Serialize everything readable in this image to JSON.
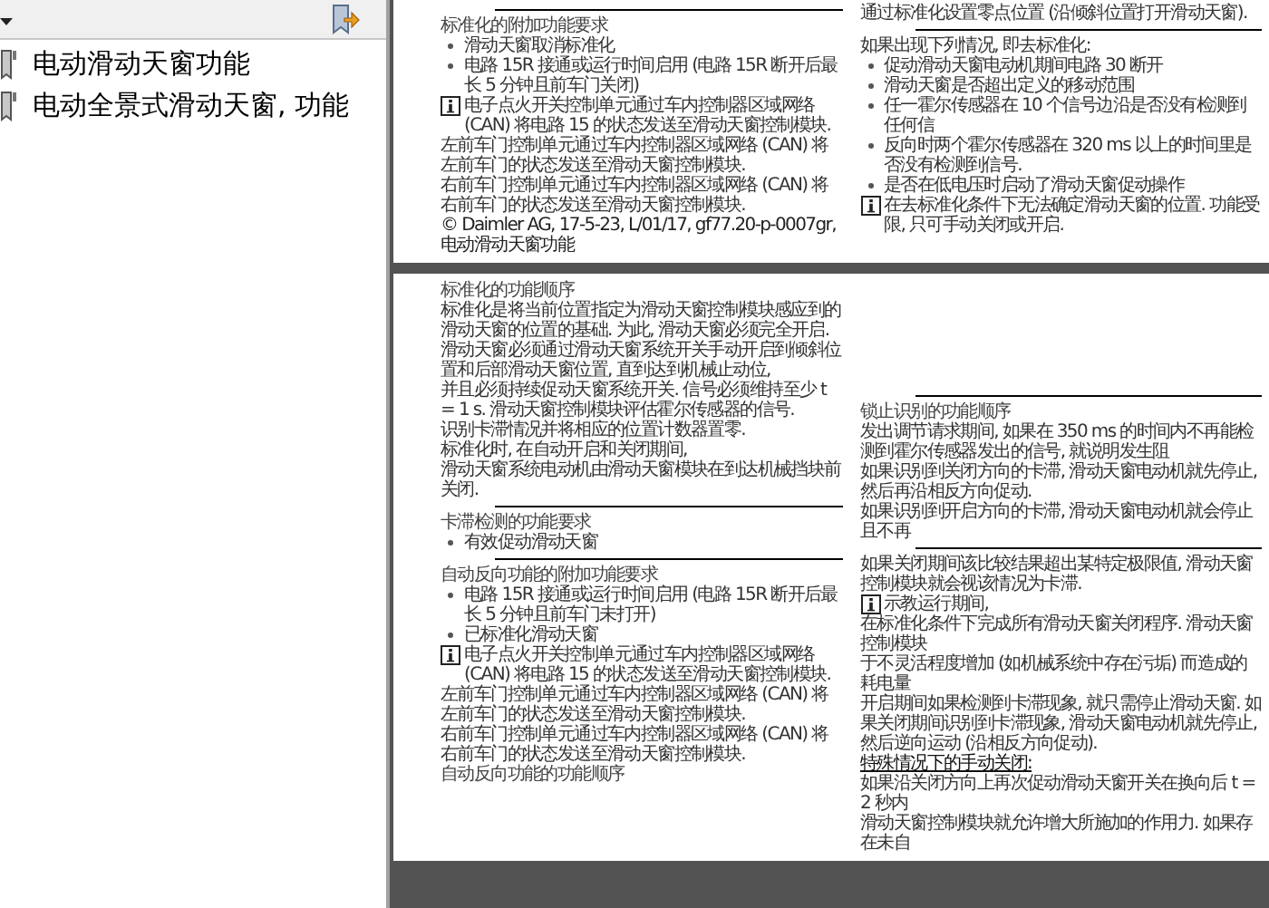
{
  "sidebar": {
    "items": [
      {
        "label": "电动滑动天窗功能"
      },
      {
        "label": "电动全景式滑动天窗, 功能"
      }
    ]
  },
  "pages": [
    {
      "columns": [
        [
          {
            "kind": "rule"
          },
          {
            "kind": "heading",
            "text": "标准化的附加功能要求"
          },
          {
            "kind": "bullet",
            "text": "滑动天窗取消标准化"
          },
          {
            "kind": "bullet",
            "text": "电路 15R 接通或运行时间启用 (电路 15R 断开后最长 5 分钟且前车门关闭)"
          },
          {
            "kind": "info",
            "text": "电子点火开关控制单元通过车内控制器区域网络 (CAN) 将电路 15 的状态发送至滑动天窗控制模块."
          },
          {
            "kind": "para",
            "text": "左前车门控制单元通过车内控制器区域网络 (CAN) 将左前车门的状态发送至滑动天窗控制模块."
          },
          {
            "kind": "para",
            "text": "右前车门控制单元通过车内控制器区域网络 (CAN) 将右前车门的状态发送至滑动天窗控制模块."
          },
          {
            "kind": "note",
            "text": "© Daimler AG, 17-5-23, L/01/17, gf77.20-p-0007gr, 电动滑动天窗功能"
          }
        ],
        [
          {
            "kind": "para",
            "text": "通过标准化设置零点位置 (沿倾斜位置打开滑动天窗)."
          },
          {
            "kind": "rule"
          },
          {
            "kind": "para",
            "text": "如果出现下列情况, 即去标准化:"
          },
          {
            "kind": "bullet",
            "text": "促动滑动天窗电动机期间电路 30 断开"
          },
          {
            "kind": "bullet",
            "text": "滑动天窗是否超出定义的移动范围"
          },
          {
            "kind": "bullet",
            "text": "任一霍尔传感器在 10 个信号边沿是否没有检测到任何信"
          },
          {
            "kind": "bullet",
            "text": "反向时两个霍尔传感器在 320 ms 以上的时间里是否没有检测到信号."
          },
          {
            "kind": "bullet",
            "text": "是否在低电压时启动了滑动天窗促动操作"
          },
          {
            "kind": "info",
            "text": "在去标准化条件下无法确定滑动天窗的位置. 功能受限, 只可手动关闭或开启."
          }
        ]
      ]
    },
    {
      "columns": [
        [
          {
            "kind": "heading",
            "text": "标准化的功能顺序"
          },
          {
            "kind": "para",
            "text": "标准化是将当前位置指定为滑动天窗控制模块感应到的滑动天窗的位置的基础. 为此, 滑动天窗必须完全开启."
          },
          {
            "kind": "para",
            "text": "滑动天窗必须通过滑动天窗系统开关手动开启到倾斜位置和后部滑动天窗位置, 直到达到机械止动位,"
          },
          {
            "kind": "para",
            "text": "并且必须持续促动天窗系统开关. 信号必须维持至少 t = 1 s. 滑动天窗控制模块评估霍尔传感器的信号."
          },
          {
            "kind": "para",
            "text": "识别卡滞情况并将相应的位置计数器置零."
          },
          {
            "kind": "para",
            "text": "标准化时, 在自动开启和关闭期间,"
          },
          {
            "kind": "para",
            "text": "滑动天窗系统电动机由滑动天窗模块在到达机械挡块前关闭."
          },
          {
            "kind": "rule"
          },
          {
            "kind": "heading",
            "text": "卡滞检测的功能要求"
          },
          {
            "kind": "bullet",
            "text": "有效促动滑动天窗"
          },
          {
            "kind": "rule"
          },
          {
            "kind": "heading",
            "text": "自动反向功能的附加功能要求"
          },
          {
            "kind": "bullet",
            "text": "电路 15R 接通或运行时间启用 (电路 15R 断开后最长 5 分钟且前车门未打开)"
          },
          {
            "kind": "bullet",
            "text": "已标准化滑动天窗"
          },
          {
            "kind": "info",
            "text": "电子点火开关控制单元通过车内控制器区域网络 (CAN) 将电路 15 的状态发送至滑动天窗控制模块."
          },
          {
            "kind": "para",
            "text": "左前车门控制单元通过车内控制器区域网络 (CAN) 将左前车门的状态发送至滑动天窗控制模块."
          },
          {
            "kind": "para",
            "text": "右前车门控制单元通过车内控制器区域网络 (CAN) 将右前车门的状态发送至滑动天窗控制模块."
          },
          {
            "kind": "heading",
            "text": "自动反向功能的功能顺序"
          }
        ],
        [
          {
            "kind": "spacer"
          },
          {
            "kind": "rule"
          },
          {
            "kind": "heading",
            "text": "锁止识别的功能顺序"
          },
          {
            "kind": "para",
            "text": "发出调节请求期间, 如果在 350 ms 的时间内不再能检测到霍尔传感器发出的信号, 就说明发生阻"
          },
          {
            "kind": "para",
            "text": "如果识别到关闭方向的卡滞, 滑动天窗电动机就先停止, 然后再沿相反方向促动."
          },
          {
            "kind": "para",
            "text": "如果识别到开启方向的卡滞, 滑动天窗电动机就会停止且不再"
          },
          {
            "kind": "rule"
          },
          {
            "kind": "para",
            "text": "如果关闭期间该比较结果超出某特定极限值, 滑动天窗控制模块就会视该情况为卡滞."
          },
          {
            "kind": "info",
            "text": "示教运行期间,"
          },
          {
            "kind": "para",
            "text": "在标准化条件下完成所有滑动天窗关闭程序. 滑动天窗控制模块"
          },
          {
            "kind": "para",
            "text": "于不灵活程度增加 (如机械系统中存在污垢) 而造成的耗电量"
          },
          {
            "kind": "para",
            "text": "开启期间如果检测到卡滞现象, 就只需停止滑动天窗. 如果关闭期间识别到卡滞现象, 滑动天窗电动机就先停止, 然后逆向运动 (沿相反方向促动)."
          },
          {
            "kind": "underline",
            "text": "特殊情况下的手动关闭:"
          },
          {
            "kind": "para",
            "text": "如果沿关闭方向上再次促动滑动天窗开关在换向后 t = 2 秒内"
          },
          {
            "kind": "para",
            "text": "滑动天窗控制模块就允许增大所施加的作用力. 如果存在未自"
          }
        ]
      ]
    }
  ]
}
